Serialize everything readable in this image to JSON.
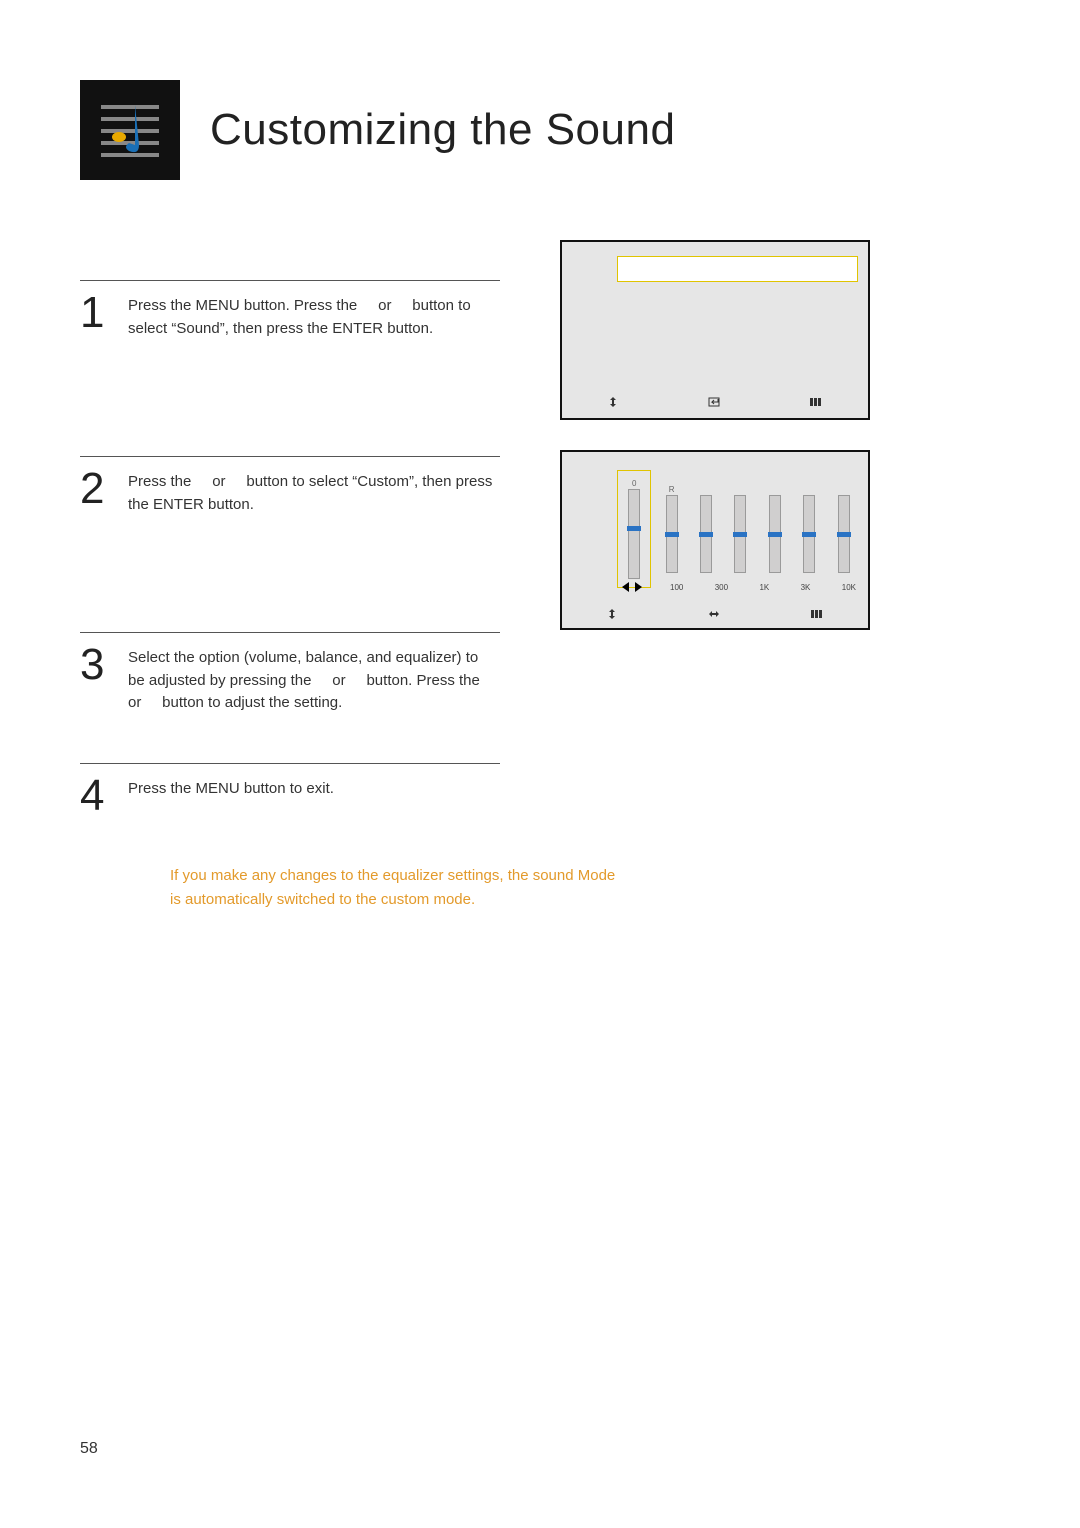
{
  "page_number": "58",
  "title": "Customizing the Sound",
  "steps": [
    {
      "num": "1",
      "text": "Press the MENU button. Press the     or     button to select “Sound”, then press the ENTER button."
    },
    {
      "num": "2",
      "text": "Press the     or     button to select “Custom”, then press the ENTER button."
    },
    {
      "num": "3",
      "text": "Select the option (volume, balance, and equalizer) to be adjusted by pressing the     or     button. Press the     or     button to adjust the setting."
    },
    {
      "num": "4",
      "text": "Press the MENU button to exit."
    }
  ],
  "screen2": {
    "vol_top": "0",
    "vol_label": "R",
    "freqs": [
      "100",
      "300",
      "1K",
      "3K",
      "10K"
    ]
  },
  "footer_icons": {
    "move": "",
    "enter": "",
    "return": ""
  },
  "note_line1": "If you make any changes to the equalizer settings, the sound Mode",
  "note_line2": "is automatically switched to the custom mode."
}
